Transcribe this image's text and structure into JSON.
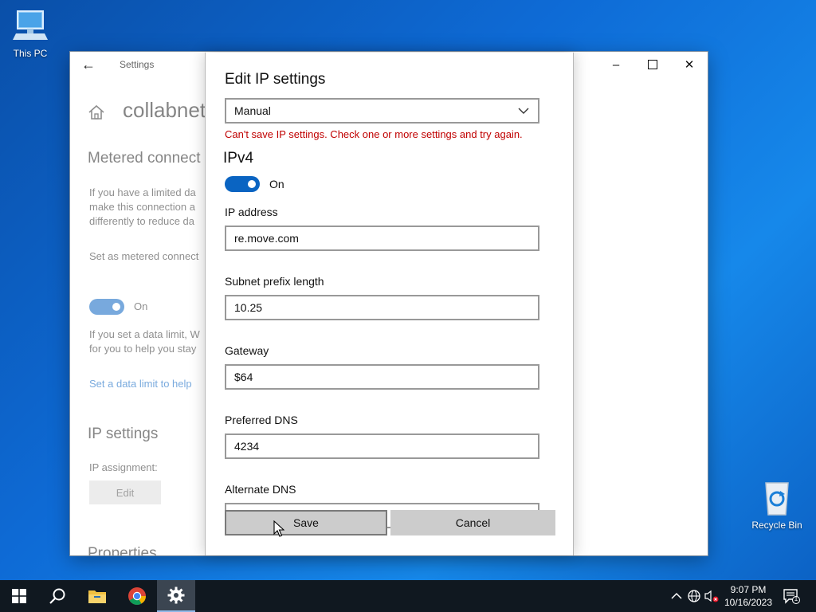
{
  "desktop": {
    "this_pc_label": "This PC",
    "recycle_bin_label": "Recycle Bin"
  },
  "window": {
    "title": "Settings",
    "page_heading": "collabnet",
    "metered_heading": "Metered connect",
    "metered_text": [
      "If you have a limited da",
      "make this connection a",
      "differently to reduce da"
    ],
    "set_metered_label": "Set as metered connect",
    "metered_toggle_state": "On",
    "data_limit_text": [
      "If you set a data limit, W",
      "for you to help you stay"
    ],
    "data_limit_link": "Set a data limit to help",
    "ip_settings_heading": "IP settings",
    "ip_assignment_label": "IP assignment:",
    "edit_button": "Edit",
    "properties_heading": "Properties"
  },
  "dialog": {
    "title": "Edit IP settings",
    "mode_selected": "Manual",
    "error_message": "Can't save IP settings. Check one or more settings and try again.",
    "ipv4_heading": "IPv4",
    "ipv4_toggle_label": "On",
    "fields": {
      "ip_address": {
        "label": "IP address",
        "value": "re.move.com"
      },
      "subnet": {
        "label": "Subnet prefix length",
        "value": "10.25"
      },
      "gateway": {
        "label": "Gateway",
        "value": "$64"
      },
      "preferred_dns": {
        "label": "Preferred DNS",
        "value": "4234"
      },
      "alternate_dns": {
        "label": "Alternate DNS",
        "value": ""
      }
    },
    "save_button": "Save",
    "cancel_button": "Cancel"
  },
  "taskbar": {
    "time": "9:07 PM",
    "date": "10/16/2023",
    "notification_count": "1"
  },
  "colors": {
    "accent": "#0a64c2",
    "error": "#c00000",
    "taskbar": "#101820"
  }
}
